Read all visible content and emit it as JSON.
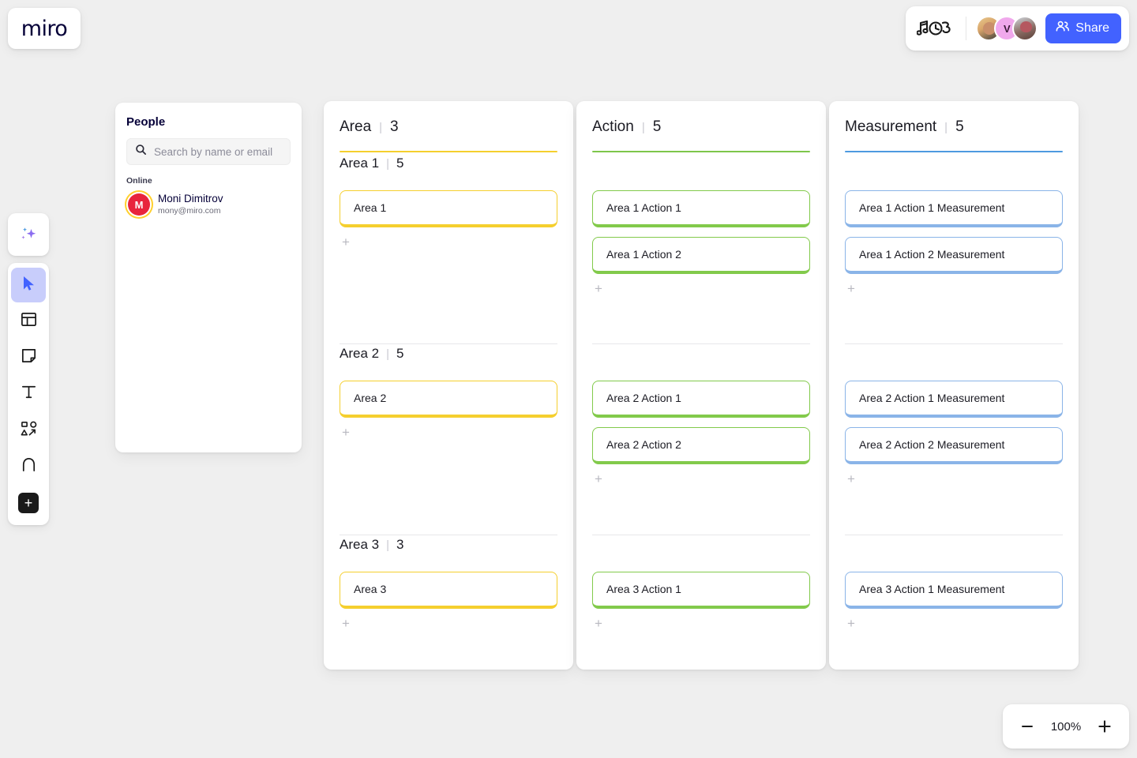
{
  "app": {
    "logo": "miro"
  },
  "topbar": {
    "doodle_icon": "music-notes-timer-doodle-icon",
    "collaborators": [
      {
        "name": "collaborator-1",
        "initial": ""
      },
      {
        "name": "collaborator-2",
        "initial": "V"
      },
      {
        "name": "collaborator-3",
        "initial": ""
      }
    ],
    "share_label": "Share",
    "share_icon": "people-icon",
    "share_color": "#4262ff"
  },
  "toolbar": {
    "items": [
      {
        "name": "ai-sparkles-tool",
        "icon": "sparkles-icon",
        "active": false
      },
      {
        "name": "select-tool",
        "icon": "cursor-icon",
        "active": true
      },
      {
        "name": "templates-tool",
        "icon": "templates-icon",
        "active": false
      },
      {
        "name": "sticky-note-tool",
        "icon": "sticky-note-icon",
        "active": false
      },
      {
        "name": "text-tool",
        "icon": "text-icon",
        "active": false
      },
      {
        "name": "shapes-tool",
        "icon": "shapes-connector-icon",
        "active": false
      },
      {
        "name": "pen-tool",
        "icon": "pen-icon",
        "active": false
      },
      {
        "name": "more-apps-tool",
        "icon": "plus-icon",
        "active": false
      }
    ]
  },
  "people_panel": {
    "title": "People",
    "search": {
      "placeholder": "Search by name or email",
      "value": "",
      "icon": "search-icon"
    },
    "section_label": "Online",
    "members": [
      {
        "initial": "M",
        "name": "Moni Dimitrov",
        "email": "mony@miro.com",
        "avatar_color": "#e8243c",
        "ring_color": "#ffd02e"
      }
    ]
  },
  "board": {
    "columns": [
      {
        "title": "Area",
        "separator": "|",
        "count": "3",
        "accent": "#f5cf2e",
        "card_border": "#f5cf2e",
        "groups": [
          {
            "title": "Area 1",
            "separator": "|",
            "count": "5",
            "cards": [
              "Area 1"
            ],
            "add_label": "+"
          },
          {
            "title": "Area 2",
            "separator": "|",
            "count": "5",
            "cards": [
              "Area 2"
            ],
            "add_label": "+"
          },
          {
            "title": "Area 3",
            "separator": "|",
            "count": "3",
            "cards": [
              "Area 3"
            ],
            "add_label": "+"
          }
        ]
      },
      {
        "title": "Action",
        "separator": "|",
        "count": "5",
        "accent": "#7ec64a",
        "card_border": "#82ca4b",
        "groups": [
          {
            "title": "",
            "separator": "",
            "count": "",
            "cards": [
              "Area 1 Action 1",
              "Area 1 Action 2"
            ],
            "add_label": "+"
          },
          {
            "title": "",
            "separator": "",
            "count": "",
            "cards": [
              "Area 2 Action 1",
              "Area 2 Action 2"
            ],
            "add_label": "+"
          },
          {
            "title": "",
            "separator": "",
            "count": "",
            "cards": [
              "Area 3 Action 1"
            ],
            "add_label": "+"
          }
        ]
      },
      {
        "title": "Measurement",
        "separator": "|",
        "count": "5",
        "accent": "#4d9ae0",
        "card_border": "#8ab4e8",
        "groups": [
          {
            "title": "",
            "separator": "",
            "count": "",
            "cards": [
              "Area 1 Action 1 Measurement",
              "Area 1 Action 2 Measurement"
            ],
            "add_label": "+"
          },
          {
            "title": "",
            "separator": "",
            "count": "",
            "cards": [
              "Area 2 Action 1 Measurement",
              "Area 2 Action 2 Measurement"
            ],
            "add_label": "+"
          },
          {
            "title": "",
            "separator": "",
            "count": "",
            "cards": [
              "Area 3 Action 1 Measurement"
            ],
            "add_label": "+"
          }
        ]
      }
    ]
  },
  "zoom_widget": {
    "minus_label": "−",
    "level": "100%",
    "plus_label": "+"
  }
}
